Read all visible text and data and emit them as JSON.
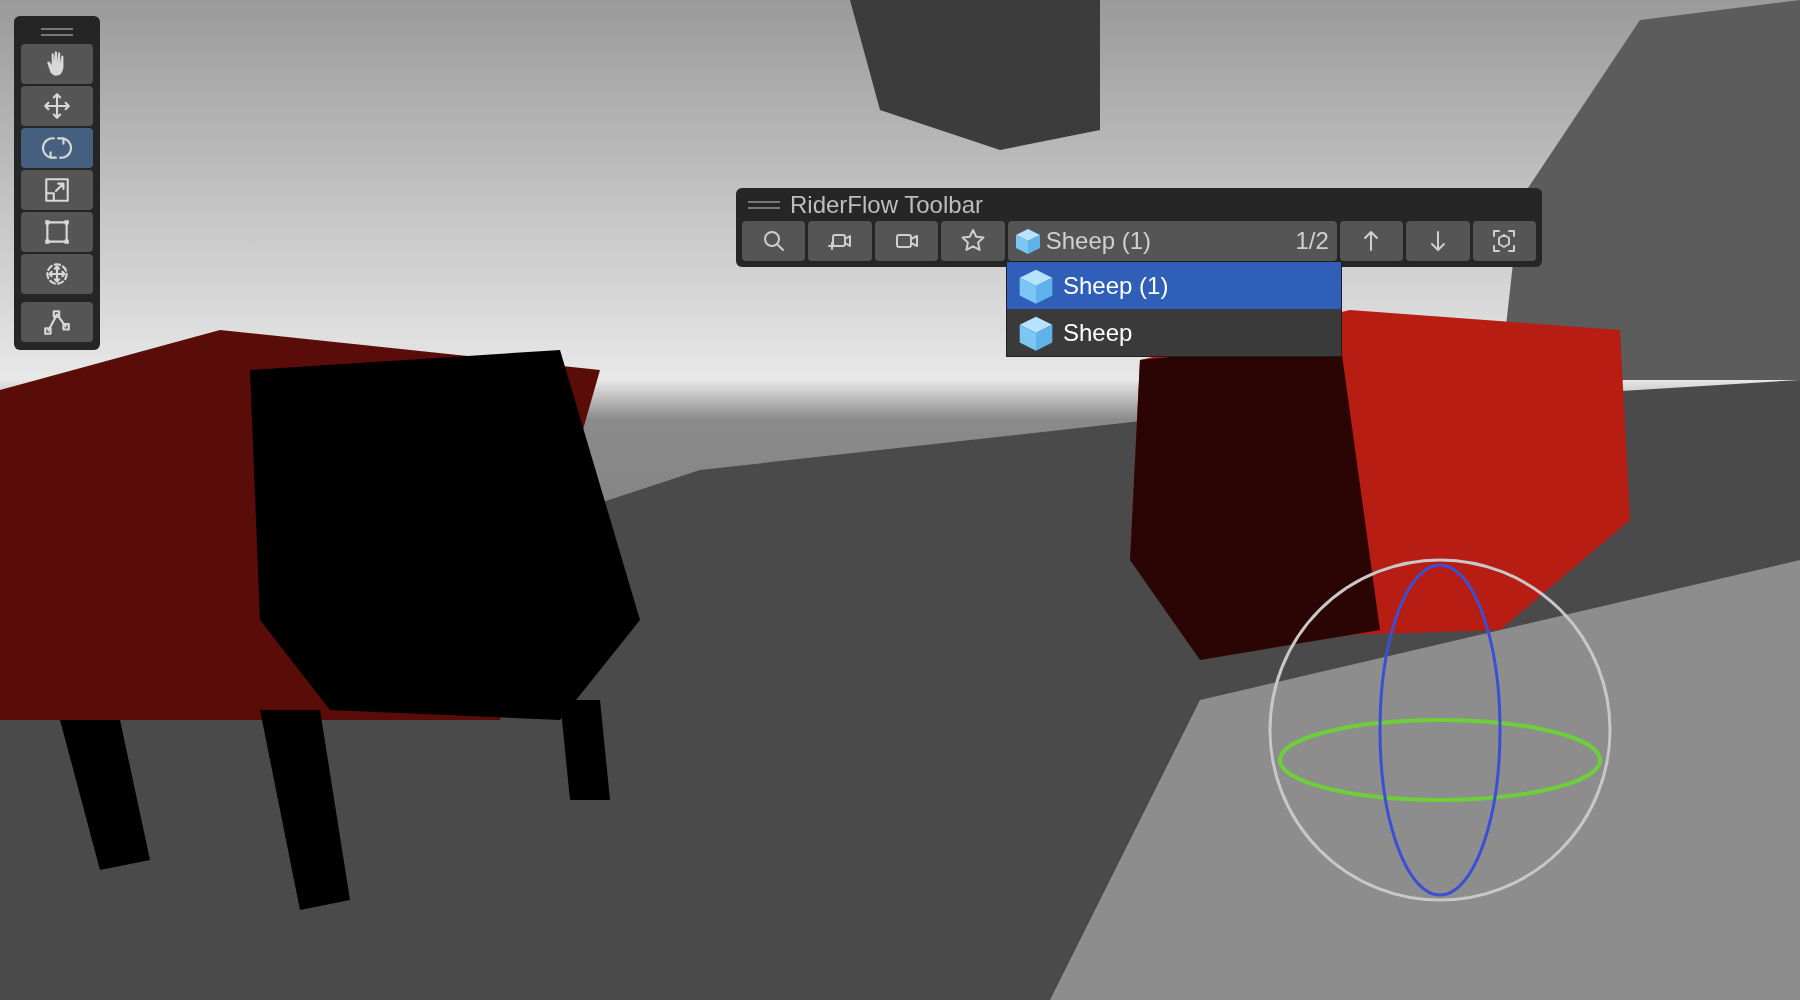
{
  "tools_panel": {
    "tools": [
      {
        "kind": "hand",
        "selected": false
      },
      {
        "kind": "move",
        "selected": false
      },
      {
        "kind": "rotate",
        "selected": true
      },
      {
        "kind": "scale",
        "selected": false
      },
      {
        "kind": "rect",
        "selected": false
      },
      {
        "kind": "transform",
        "selected": false
      },
      {
        "kind": "custom",
        "selected": false
      }
    ]
  },
  "toolbar": {
    "title": "RiderFlow Toolbar",
    "buttons": [
      {
        "kind": "search"
      },
      {
        "kind": "add-camera"
      },
      {
        "kind": "camera"
      },
      {
        "kind": "star"
      }
    ],
    "selector": {
      "value": "Sheep (1)",
      "counter": "1/2"
    },
    "nav_buttons": [
      {
        "kind": "up"
      },
      {
        "kind": "down"
      },
      {
        "kind": "frame"
      }
    ],
    "dropdown": [
      {
        "label": "Sheep (1)",
        "selected": true
      },
      {
        "label": "Sheep",
        "selected": false
      }
    ]
  }
}
